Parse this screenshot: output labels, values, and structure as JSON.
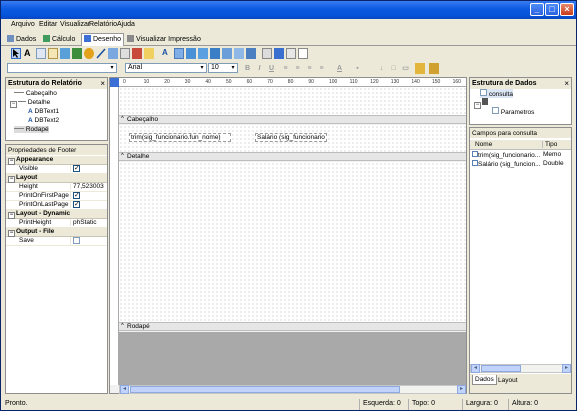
{
  "menu": [
    "Arquivo",
    "Editar",
    "Visualizar",
    "Relatório",
    "Ajuda"
  ],
  "tabs": [
    "Dados",
    "Cálculo",
    "Desenho",
    "Visualizar Impressão"
  ],
  "active_tab": "Desenho",
  "font": {
    "family": "Arial",
    "size": "10"
  },
  "report_tree": {
    "title": "Estrutura do Relatório",
    "items": [
      "Cabeçalho",
      "Detalhe",
      "DBText1",
      "DBText2",
      "Rodapé"
    ]
  },
  "properties": {
    "title": "Propriedades de Footer",
    "groups": [
      {
        "name": "Appearance",
        "rows": [
          {
            "name": "Visible",
            "value": "checked"
          }
        ]
      },
      {
        "name": "Layout",
        "rows": [
          {
            "name": "Height",
            "value": "77,523003"
          },
          {
            "name": "PrintOnFirstPage",
            "value": "checked"
          },
          {
            "name": "PrintOnLastPage",
            "value": "checked"
          }
        ]
      },
      {
        "name": "Layout - Dynamic",
        "rows": [
          {
            "name": "PrintHeight",
            "value": "phStatic"
          }
        ]
      },
      {
        "name": "Output - File",
        "rows": [
          {
            "name": "Save",
            "value": "unchecked"
          }
        ]
      }
    ]
  },
  "ruler_ticks": [
    "0",
    "10",
    "20",
    "30",
    "40",
    "50",
    "60",
    "70",
    "80",
    "90",
    "100",
    "110",
    "120",
    "130",
    "140",
    "150",
    "160"
  ],
  "bands": {
    "header": "Cabeçalho",
    "detail": "Detalhe",
    "footer": "Rodapé"
  },
  "db_texts": [
    "trim(sig_funcionario.fun_nome)",
    "Salário (sig_funcionario"
  ],
  "data_structure": {
    "title": "Estrutura de Dados",
    "items": [
      "consulta",
      "Parametros"
    ]
  },
  "fields": {
    "title": "Campos para consulta",
    "columns": [
      "Nome",
      "Tipo"
    ],
    "rows": [
      {
        "name": "trim(sig_funcionario...",
        "type": "Memo"
      },
      {
        "name": "Salário (sig_funcion...",
        "type": "Double"
      }
    ]
  },
  "right_tabs": [
    "Dados",
    "Layout"
  ],
  "status": {
    "text": "Pronto.",
    "esquerda": "Esquerda: 0",
    "topo": "Topo: 0",
    "largura": "Largura: 0",
    "altura": "Altura: 0"
  }
}
